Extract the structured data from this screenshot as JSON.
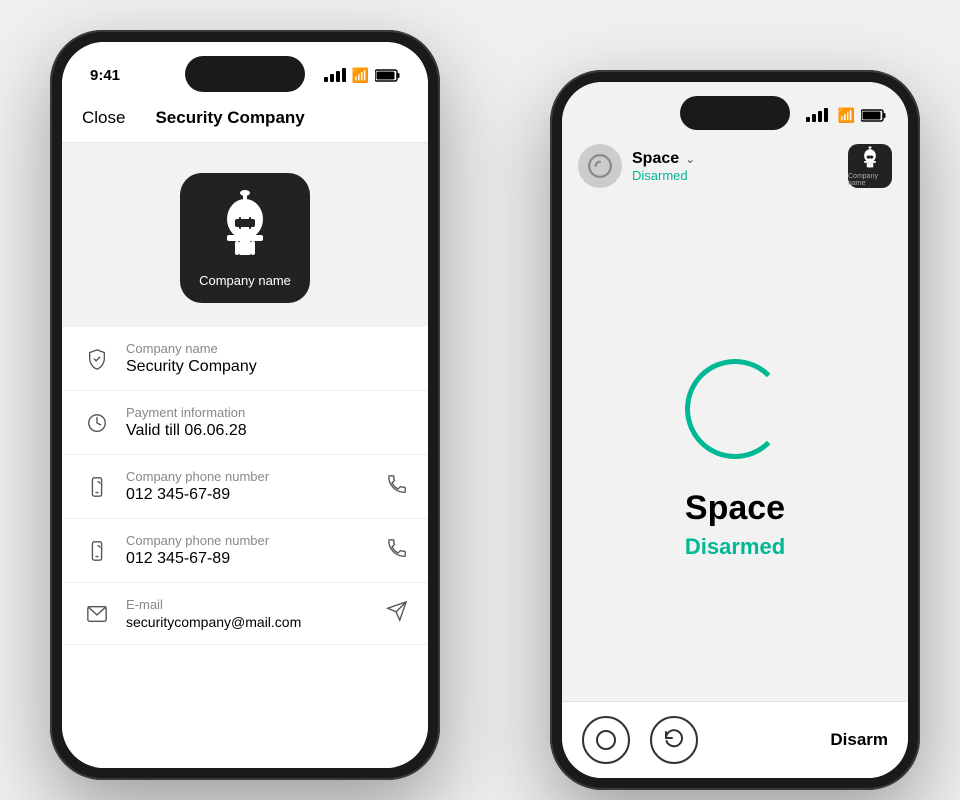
{
  "leftPhone": {
    "statusBar": {
      "time": "9:41"
    },
    "navBar": {
      "closeLabel": "Close",
      "titleLabel": "Security Company"
    },
    "companyHeader": {
      "logoLabel": "Company name"
    },
    "infoItems": [
      {
        "id": "company-name",
        "label": "Company name",
        "value": "Security Company",
        "hasAction": false
      },
      {
        "id": "payment",
        "label": "Payment information",
        "value": "Valid till 06.06.28",
        "hasAction": false
      },
      {
        "id": "phone1",
        "label": "Company phone number",
        "value": "012 345-67-89",
        "hasAction": true
      },
      {
        "id": "phone2",
        "label": "Company phone number",
        "value": "012 345-67-89",
        "hasAction": true
      },
      {
        "id": "email",
        "label": "E-mail",
        "value": "securitycompany@mail.com",
        "hasAction": true
      }
    ]
  },
  "rightPhone": {
    "topBar": {
      "spaceName": "Space",
      "spaceStatus": "Disarmed",
      "companyBadgeLabel": "Company name"
    },
    "main": {
      "name": "Space",
      "status": "Disarmed"
    },
    "bottomBar": {
      "disarmLabel": "Disarm"
    }
  }
}
